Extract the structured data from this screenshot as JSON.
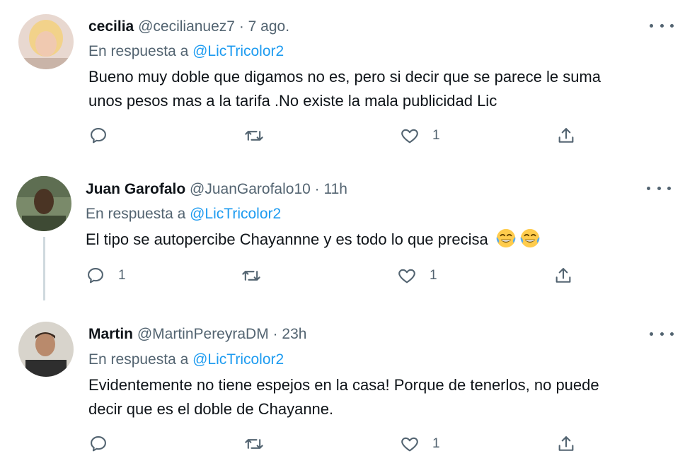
{
  "tweets": [
    {
      "name": "cecilia",
      "handle": "@cecilianuez7",
      "sep": "·",
      "time": "7 ago.",
      "reply_prefix": "En respuesta a",
      "reply_to": "@LicTricolor2",
      "text_line1": "Bueno muy doble que digamos no es, pero si decir que se parece le suma",
      "text_line2": "unos pesos mas a la tarifa .No existe la mala publicidad Lic",
      "reply_count": "",
      "retweet_count": "",
      "like_count": "1"
    },
    {
      "name": "Juan Garofalo",
      "handle": "@JuanGarofalo10",
      "sep": "·",
      "time": "11h",
      "reply_prefix": "En respuesta a",
      "reply_to": "@LicTricolor2",
      "text_line1": "El tipo se autopercibe Chayannne y es todo lo que precisa",
      "emojis": [
        "face-with-tears-of-joy",
        "face-with-tears-of-joy"
      ],
      "reply_count": "1",
      "retweet_count": "",
      "like_count": "1"
    },
    {
      "name": "Martin",
      "handle": "@MartinPereyraDM",
      "sep": "·",
      "time": "23h",
      "reply_prefix": "En respuesta a",
      "reply_to": "@LicTricolor2",
      "text_line1": "Evidentemente no tiene espejos en la casa! Porque de tenerlos, no puede",
      "text_line2": "decir que es el doble de Chayanne.",
      "reply_count": "",
      "retweet_count": "",
      "like_count": "1"
    }
  ],
  "colors": {
    "text": "#0f1419",
    "secondary": "#536471",
    "link": "#1d9bf0",
    "thread_line": "#cfd9de"
  },
  "icons": [
    "reply-icon",
    "retweet-icon",
    "like-icon",
    "share-icon",
    "more-icon"
  ]
}
